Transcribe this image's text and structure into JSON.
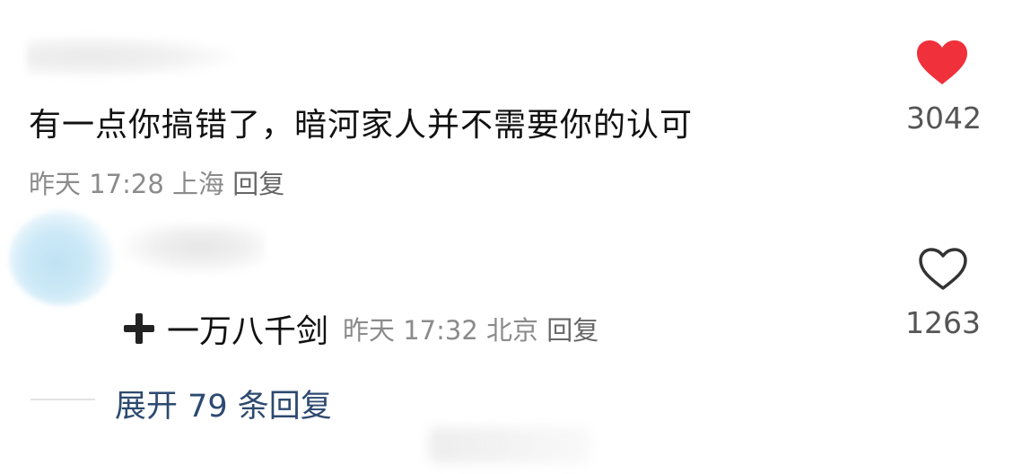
{
  "comment1": {
    "text": "有一点你搞错了，暗河家人并不需要你的认可",
    "time": "昨天 17:28",
    "location": "上海",
    "reply_label": "回复",
    "like_count": "3042",
    "liked": true
  },
  "comment2": {
    "prefix_text": "一万八千剑",
    "time": "昨天 17:32",
    "location": "北京",
    "reply_label": "回复",
    "like_count": "1263",
    "liked": false
  },
  "expand_replies_label": "展开 79 条回复",
  "colors": {
    "like_red": "#f0303a",
    "link_blue": "#2d4a70",
    "meta_gray": "#8b8b8b"
  }
}
